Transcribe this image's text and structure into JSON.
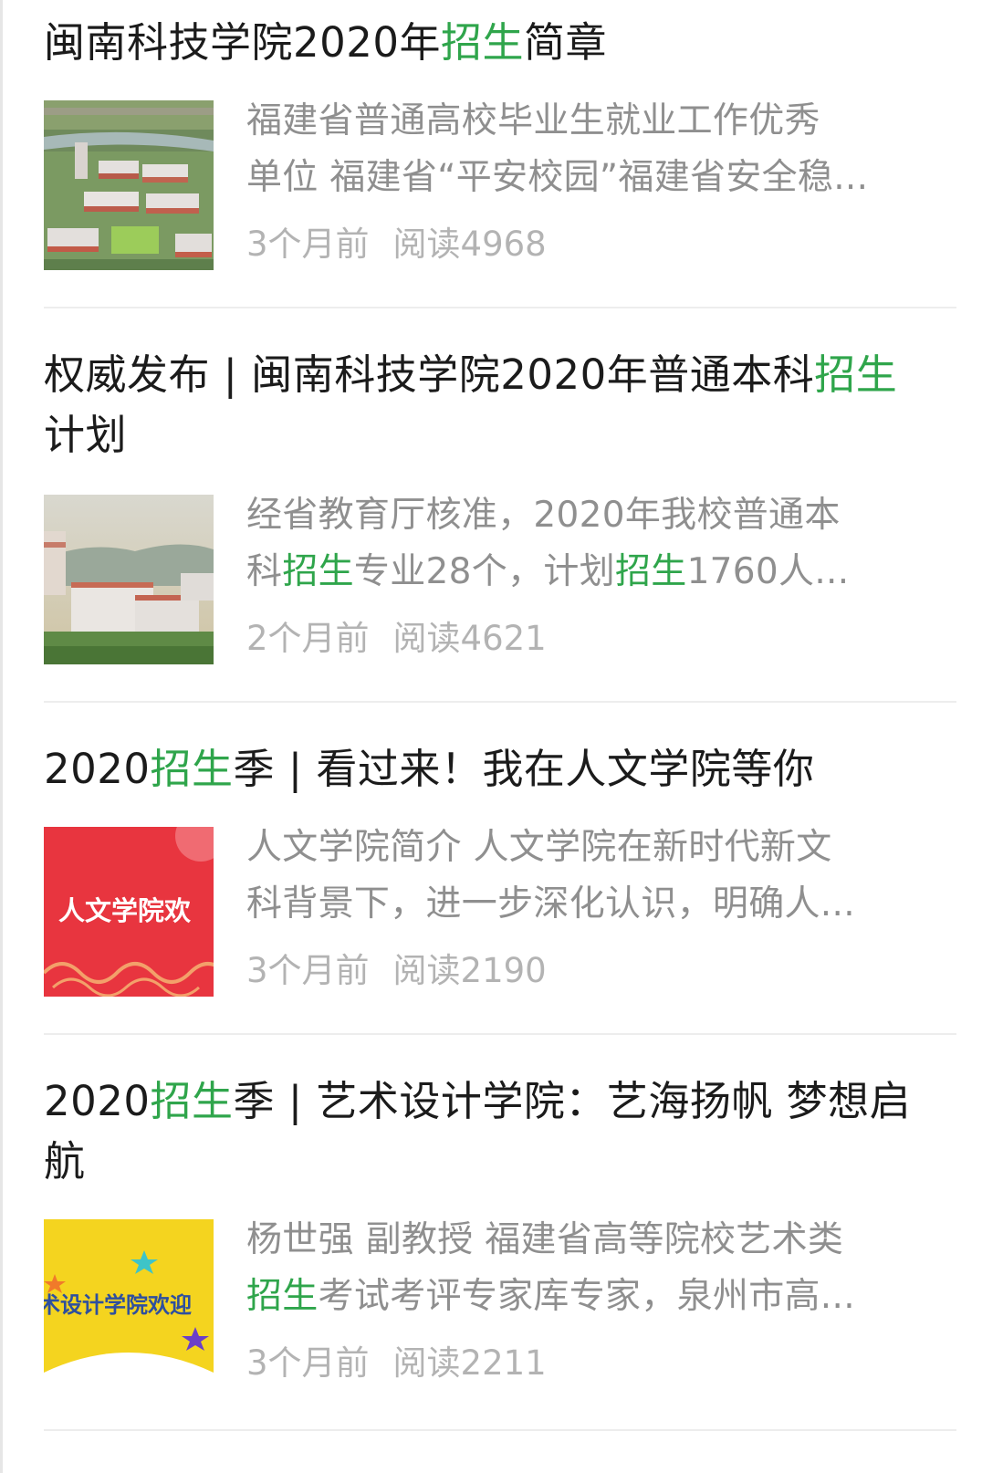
{
  "articles": [
    {
      "title": [
        {
          "text": "闽南科技学院2020年",
          "hl": false
        },
        {
          "text": "招生",
          "hl": true
        },
        {
          "text": "简章",
          "hl": false
        }
      ],
      "desc_lines": [
        [
          {
            "text": "福建省普通高校毕业生就业工作优秀",
            "hl": false
          }
        ],
        [
          {
            "text": "单位 福建省“平安校园”福建省安全稳...",
            "hl": false
          }
        ]
      ],
      "time": "3个月前",
      "reads": "阅读4968",
      "thumb_icon": "campus-aerial-image"
    },
    {
      "title": [
        {
          "text": "权威发布 | 闽南科技学院2020年普通本科",
          "hl": false
        },
        {
          "text": "招生",
          "hl": true
        },
        {
          "text": "计划",
          "hl": false
        }
      ],
      "desc_lines": [
        [
          {
            "text": "经省教育厅核准，2020年我校普通本",
            "hl": false
          }
        ],
        [
          {
            "text": "科",
            "hl": false
          },
          {
            "text": "招生",
            "hl": true
          },
          {
            "text": "专业28个，计划",
            "hl": false
          },
          {
            "text": "招生",
            "hl": true
          },
          {
            "text": "1760人...",
            "hl": false
          }
        ]
      ],
      "time": "2个月前",
      "reads": "阅读4621",
      "thumb_icon": "campus-building-image"
    },
    {
      "title": [
        {
          "text": "2020",
          "hl": false
        },
        {
          "text": "招生",
          "hl": true
        },
        {
          "text": "季 | 看过来！我在人文学院等你",
          "hl": false
        }
      ],
      "desc_lines": [
        [
          {
            "text": "人文学院简介 人文学院在新时代新文",
            "hl": false
          }
        ],
        [
          {
            "text": "科背景下，进一步深化认识，明确人...",
            "hl": false
          }
        ]
      ],
      "time": "3个月前",
      "reads": "阅读2190",
      "thumb_icon": "red-banner-image",
      "thumb_text": "人文学院欢"
    },
    {
      "title": [
        {
          "text": "2020",
          "hl": false
        },
        {
          "text": "招生",
          "hl": true
        },
        {
          "text": "季 | 艺术设计学院：艺海扬帆 梦想启航",
          "hl": false
        }
      ],
      "desc_lines": [
        [
          {
            "text": "杨世强 副教授 福建省高等院校艺术类",
            "hl": false
          }
        ],
        [
          {
            "text": "招生",
            "hl": true
          },
          {
            "text": "考试考评专家库专家，泉州市高...",
            "hl": false
          }
        ]
      ],
      "time": "3个月前",
      "reads": "阅读2211",
      "thumb_icon": "yellow-banner-image",
      "thumb_text": "术设计学院欢迎"
    }
  ],
  "colors": {
    "highlight": "#2fa54b",
    "title": "#1b1b1b",
    "desc": "#8f8f8f",
    "meta": "#b3b3b3"
  }
}
